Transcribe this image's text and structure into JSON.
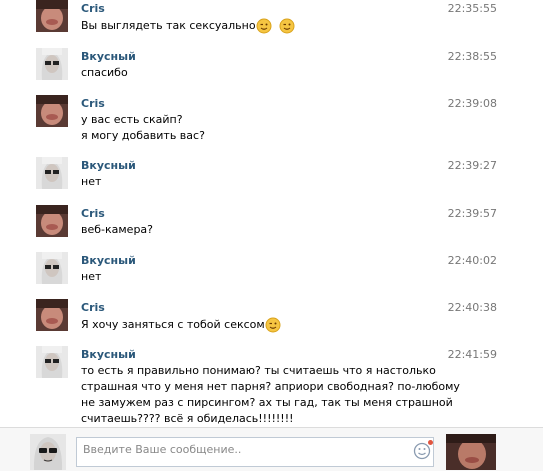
{
  "messages": [
    {
      "author": "Cris",
      "time": "22:35:55",
      "lines": [
        "Вы выглядеть так сексуально"
      ],
      "smileys": 2
    },
    {
      "author": "Вкусный",
      "time": "22:38:55",
      "lines": [
        "спасибо"
      ],
      "smileys": 0
    },
    {
      "author": "Cris",
      "time": "22:39:08",
      "lines": [
        "у вас есть скайп?",
        "я могу добавить вас?"
      ],
      "smileys": 0
    },
    {
      "author": "Вкусный",
      "time": "22:39:27",
      "lines": [
        "нет"
      ],
      "smileys": 0
    },
    {
      "author": "Cris",
      "time": "22:39:57",
      "lines": [
        "веб-камера?"
      ],
      "smileys": 0
    },
    {
      "author": "Вкусный",
      "time": "22:40:02",
      "lines": [
        "нет"
      ],
      "smileys": 0
    },
    {
      "author": "Cris",
      "time": "22:40:38",
      "lines": [
        "Я хочу заняться с тобой сексом"
      ],
      "smileys": 1
    },
    {
      "author": "Вкусный",
      "time": "22:41:59",
      "lines": [
        "то есть я правильно понимаю? ты считаешь что я настолько страшная что у меня нет парня? априори свободная? по-любому не замужем раз с пирсингом? ах ты гад, так ты меня страшной считаешь???? всё я обиделась!!!!!!!!"
      ],
      "smileys": 0
    }
  ],
  "composer": {
    "placeholder": "Введите Ваше сообщение.."
  },
  "icons": {
    "smiley": "wink-smiley-icon",
    "emoji_button": "smiley-face-icon"
  },
  "colors": {
    "author": "#2b587a",
    "time": "#777777",
    "smiley": "#f5c542"
  }
}
